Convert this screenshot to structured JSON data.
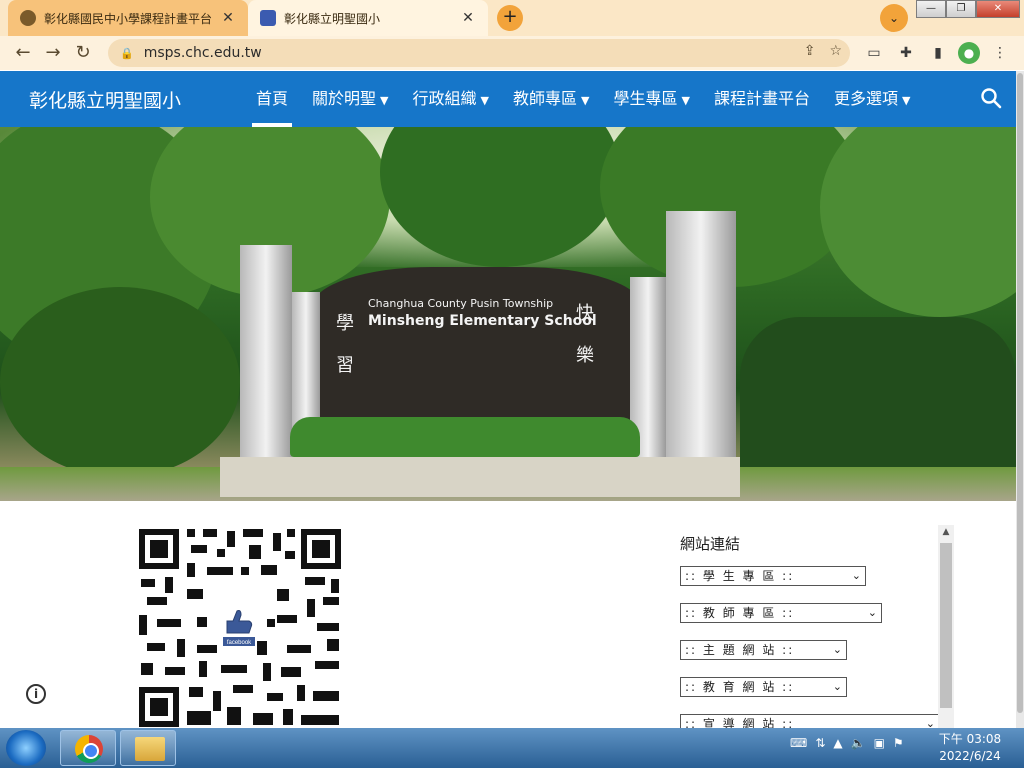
{
  "browser": {
    "tabs": [
      {
        "title": "彰化縣國民中小學課程計畫平台",
        "active": false,
        "close": "✕"
      },
      {
        "title": "彰化縣立明聖國小",
        "active": true,
        "close": "✕"
      }
    ],
    "new_tab": "+",
    "url": "msps.chc.edu.tw"
  },
  "site": {
    "title": "彰化縣立明聖國小",
    "menu": [
      {
        "label": "首頁",
        "active": true,
        "dropdown": false
      },
      {
        "label": "關於明聖",
        "dropdown": true
      },
      {
        "label": "行政組織",
        "dropdown": true
      },
      {
        "label": "教師專區",
        "dropdown": true
      },
      {
        "label": "學生專區",
        "dropdown": true
      },
      {
        "label": "課程計畫平台",
        "dropdown": false
      },
      {
        "label": "更多選項",
        "dropdown": true
      }
    ],
    "accent": "#1676c9"
  },
  "hero": {
    "sign_line1": "Changhua County    Pusin Township",
    "sign_line2": "Minsheng Elementary School",
    "left_chars": "學 習",
    "right_chars": "快 樂"
  },
  "links": {
    "title": "網站連結",
    "selects": [
      ":: 學 生 專 區 ::",
      ":: 教 師 專 區 ::",
      ":: 主 題 網 站 ::",
      ":: 教 育 網 站 ::",
      ":: 宣 導 網 站 ::"
    ]
  },
  "qr_badge": "facebook",
  "taskbar": {
    "time": "下午 03:08",
    "date": "2022/6/24"
  }
}
